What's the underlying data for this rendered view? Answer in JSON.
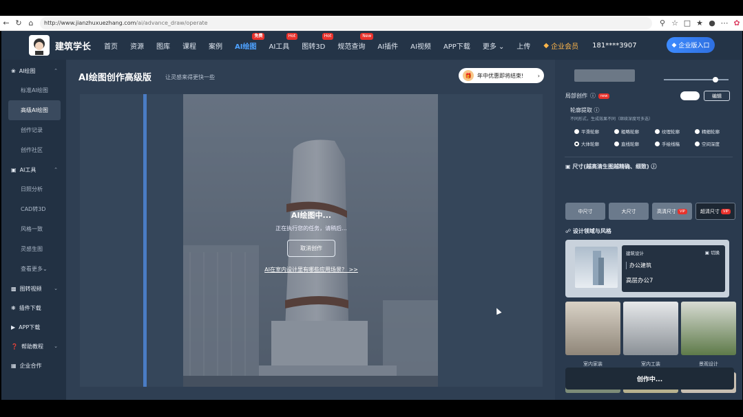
{
  "browser": {
    "url_host": "http://www.jianzhuxuezhang.com",
    "url_path": "/ai/advance_draw/operate"
  },
  "nav": {
    "brand": "建筑学长",
    "items": [
      {
        "label": "首页"
      },
      {
        "label": "资源"
      },
      {
        "label": "图库"
      },
      {
        "label": "课程"
      },
      {
        "label": "案例"
      },
      {
        "label": "AI绘图",
        "badge": "免费"
      },
      {
        "label": "AI工具",
        "badge": "Hot"
      },
      {
        "label": "图转3D",
        "badge": "Hot"
      },
      {
        "label": "规范查询",
        "badge": "New"
      },
      {
        "label": "AI插件"
      },
      {
        "label": "AI视频"
      },
      {
        "label": "APP下载"
      },
      {
        "label": "更多"
      },
      {
        "label": "上传"
      }
    ],
    "vip": "企业会员",
    "user": "181****3907",
    "enterprise": "企业版入口"
  },
  "sidebar": {
    "groups": [
      {
        "label": "AI绘图",
        "items": [
          "标准AI绘图",
          "高级AI绘图",
          "创作记录",
          "创作社区"
        ]
      },
      {
        "label": "AI工具",
        "items": [
          "日照分析",
          "CAD转3D",
          "风格一致",
          "灵感生图",
          "查看更多"
        ]
      },
      {
        "label": "图转视频",
        "items": []
      },
      {
        "label": "插件下载",
        "items": []
      },
      {
        "label": "APP下载",
        "items": []
      },
      {
        "label": "帮助教程",
        "items": []
      },
      {
        "label": "企业合作",
        "items": []
      }
    ]
  },
  "main": {
    "title": "AI绘图创作高级版",
    "subtitle": "让灵感来得更快一些",
    "promo": "年中优惠即将结束!",
    "generating_title": "AI绘图中...",
    "generating_desc": "正在执行您的任务，请稍后...",
    "cancel": "取消创作",
    "tip": "AI在室内设计里有哪些应用场景？ >>"
  },
  "panel": {
    "partial_title": "局部创作",
    "partial_badge": "new",
    "edit": "编辑",
    "contour_title": "轮廓提取",
    "contour_note": "不同形式，生成效果不同（继续深度可多选）",
    "contour_options": [
      "平滑轮廓",
      "粗略轮廓",
      "纹理轮廓",
      "精细轮廓",
      "大体轮廓",
      "直线轮廓",
      "手绘线稿",
      "空间深度"
    ],
    "contour_selected": 4,
    "size_title": "尺寸(越高清生图越精确、细致)",
    "sizes": [
      "中尺寸",
      "大尺寸",
      "高清尺寸",
      "超清尺寸"
    ],
    "size_selected": 3,
    "field_title": "设计领域与风格",
    "field_tag": "建筑设计",
    "field_switch": "切换",
    "field_type": "办公建筑",
    "field_style": "高层办公7",
    "thumbs": [
      "室内家装",
      "室内工装",
      "景观设计"
    ],
    "create": "创作中..."
  }
}
